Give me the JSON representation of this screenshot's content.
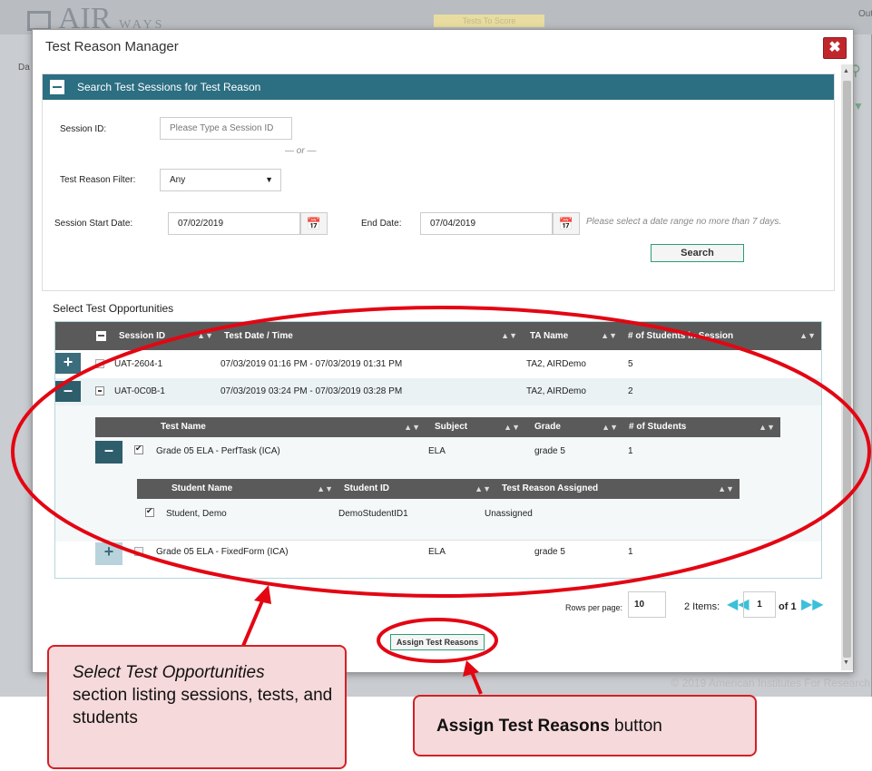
{
  "background": {
    "logo_text": "AIR",
    "logo_sub": "WAYS",
    "badge_text": "Tests To Score",
    "out_text": "Out",
    "da_text": "Da",
    "footer_text": "© 2019 American Institutes For Research"
  },
  "dialog": {
    "title": "Test Reason Manager",
    "close_icon": "close-icon"
  },
  "search_panel": {
    "heading": "Search Test Sessions for Test Reason",
    "session_id_label": "Session ID:",
    "session_id_placeholder": "Please Type a Session ID",
    "or_text": "— or —",
    "filter_label": "Test Reason Filter:",
    "filter_value": "Any",
    "start_date_label": "Session Start Date:",
    "start_date_value": "07/02/2019",
    "end_date_label": "End Date:",
    "end_date_value": "07/04/2019",
    "date_hint": "Please select a date range no more than 7 days.",
    "search_button": "Search"
  },
  "opportunities": {
    "section_title": "Select Test Opportunities",
    "columns": [
      "Session ID",
      "Test Date / Time",
      "TA Name",
      "# of Students in Session"
    ],
    "sessions": [
      {
        "session_id": "UAT-2604-1",
        "date_time": "07/03/2019 01:16 PM - 07/03/2019 01:31 PM",
        "ta_name": "TA2, AIRDemo",
        "students": "5"
      },
      {
        "session_id": "UAT-0C0B-1",
        "date_time": "07/03/2019 03:24 PM - 07/03/2019 03:28 PM",
        "ta_name": "TA2, AIRDemo",
        "students": "2"
      }
    ],
    "test_columns": [
      "Test Name",
      "Subject",
      "Grade",
      "# of Students"
    ],
    "tests": [
      {
        "name": "Grade 05 ELA - PerfTask (ICA)",
        "subject": "ELA",
        "grade": "grade 5",
        "students": "1"
      },
      {
        "name": "Grade 05 ELA - FixedForm (ICA)",
        "subject": "ELA",
        "grade": "grade 5",
        "students": "1"
      }
    ],
    "student_columns": [
      "Student Name",
      "Student ID",
      "Test Reason Assigned"
    ],
    "students": [
      {
        "name": "Student, Demo",
        "id": "DemoStudentID1",
        "reason": "Unassigned"
      }
    ],
    "rows_per_page_label": "Rows per page:",
    "rows_per_page_value": "10",
    "items_label": "2 Items:",
    "page_value": "1",
    "page_of": "of 1"
  },
  "assign_button": "Assign Test Reasons",
  "callouts": {
    "left_italic": "Select Test Opportunities",
    "left_rest": "section listing sessions, tests, and students",
    "right_bold": "Assign Test Reasons",
    "right_rest": " button"
  },
  "colors": {
    "panel_header": "#2c6e82",
    "annotation_red": "#e30613",
    "callout_fill": "#f6d9da",
    "button_border": "#2a9d78"
  }
}
